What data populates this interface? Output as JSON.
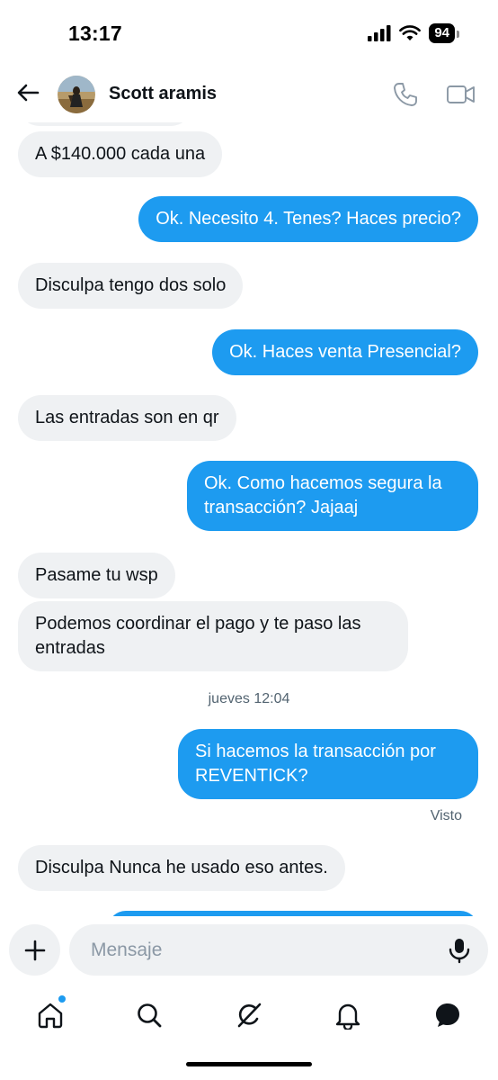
{
  "status_bar": {
    "time": "13:17",
    "battery": "94"
  },
  "header": {
    "contact_name": "Scott aramis"
  },
  "messages": [
    {
      "direction": "in",
      "text": "A $140.000 cada una"
    },
    {
      "direction": "out",
      "text": "Ok. Necesito 4. Tenes? Haces precio?"
    },
    {
      "direction": "in",
      "text": "Disculpa tengo dos solo"
    },
    {
      "direction": "out",
      "text": "Ok. Haces venta Presencial?"
    },
    {
      "direction": "in",
      "text": "Las entradas son en qr"
    },
    {
      "direction": "out",
      "text": "Ok. Como hacemos segura la transacción? Jajaaj"
    },
    {
      "direction": "in",
      "text": "Pasame tu wsp"
    },
    {
      "direction": "in",
      "text": "Podemos coordinar el pago y te paso las entradas"
    },
    {
      "direction": "out",
      "text": "Si hacemos la transacción por REVENTICK?"
    },
    {
      "direction": "in",
      "text": "Disculpa Nunca he usado eso antes."
    }
  ],
  "time_divider": "jueves 12:04",
  "seen_label": "Visto",
  "composer": {
    "placeholder": "Mensaje"
  },
  "colors": {
    "accent": "#1d9bf0",
    "incoming_bubble": "#eff1f3",
    "text": "#0f1419",
    "muted": "#536471"
  },
  "icons": [
    "back-arrow-icon",
    "phone-icon",
    "video-camera-icon",
    "plus-icon",
    "microphone-icon",
    "home-icon",
    "search-icon",
    "grok-icon",
    "bell-icon",
    "messages-icon"
  ]
}
